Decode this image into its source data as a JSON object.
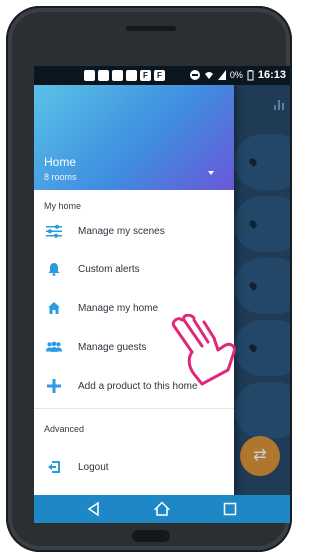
{
  "statusbar": {
    "battery": "0%",
    "time": "16:13"
  },
  "drawer": {
    "home_title": "Home",
    "home_subtitle": "8 rooms",
    "section_my_home": "My home",
    "items": [
      {
        "label": "Manage my scenes",
        "icon": "sliders-icon"
      },
      {
        "label": "Custom alerts",
        "icon": "bell-icon"
      },
      {
        "label": "Manage my home",
        "icon": "house-icon"
      },
      {
        "label": "Manage guests",
        "icon": "people-icon"
      },
      {
        "label": "Add a product to this home",
        "icon": "plus-icon"
      }
    ],
    "section_advanced": "Advanced",
    "logout_label": "Logout"
  },
  "colors": {
    "accent": "#1e88c6",
    "icon_blue": "#2a9be0",
    "header_gradient_start": "#59c2e6",
    "header_gradient_end": "#6a57d8",
    "hand_color": "#e0287a"
  }
}
